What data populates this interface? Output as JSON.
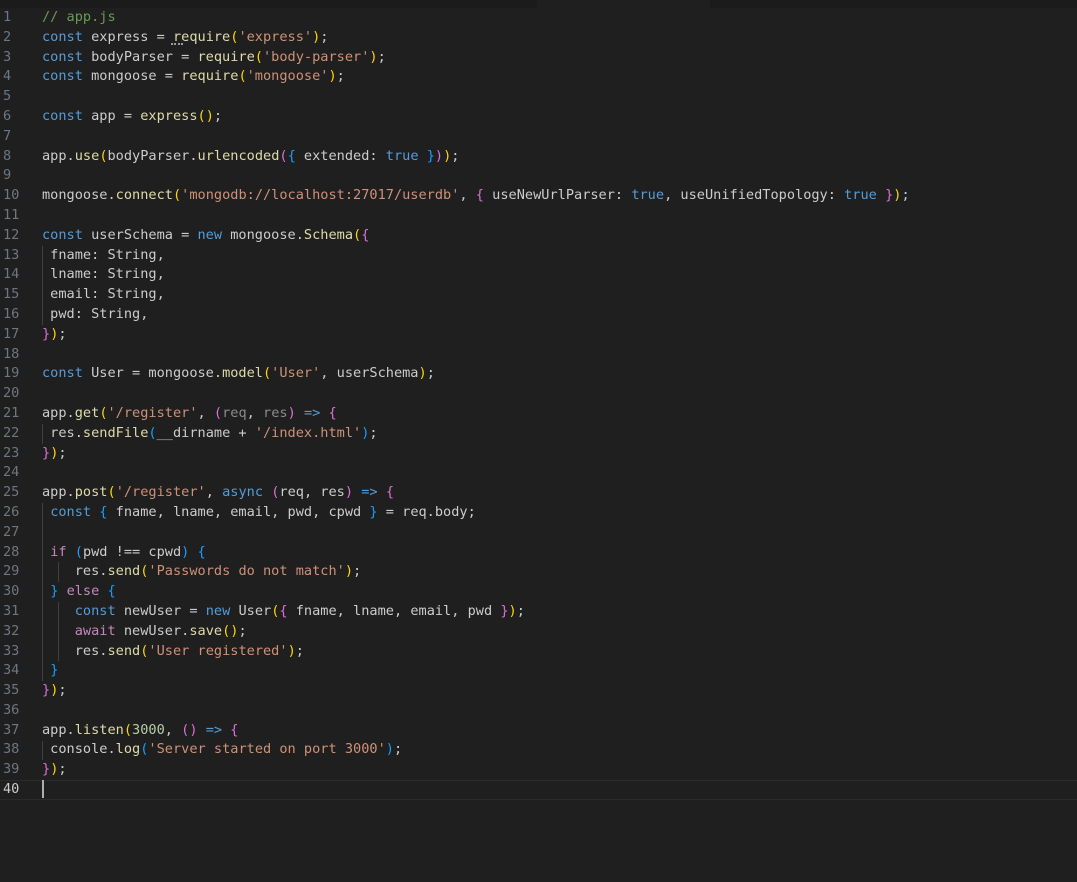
{
  "editor": {
    "current_line": 40,
    "lines": [
      {
        "n": "1",
        "tokens": [
          [
            "comment",
            "// app.js"
          ]
        ]
      },
      {
        "n": "2",
        "tokens": [
          [
            "keyword",
            "const"
          ],
          [
            "plain",
            " express = "
          ],
          [
            "fn",
            "require"
          ],
          [
            "b1",
            "("
          ],
          [
            "str",
            "'express'"
          ],
          [
            "b1",
            ")"
          ],
          [
            "plain",
            ";"
          ]
        ]
      },
      {
        "n": "3",
        "tokens": [
          [
            "keyword",
            "const"
          ],
          [
            "plain",
            " bodyParser = "
          ],
          [
            "fn",
            "require"
          ],
          [
            "b1",
            "("
          ],
          [
            "str",
            "'body-parser'"
          ],
          [
            "b1",
            ")"
          ],
          [
            "plain",
            ";"
          ]
        ]
      },
      {
        "n": "4",
        "tokens": [
          [
            "keyword",
            "const"
          ],
          [
            "plain",
            " mongoose = "
          ],
          [
            "fn",
            "require"
          ],
          [
            "b1",
            "("
          ],
          [
            "str",
            "'mongoose'"
          ],
          [
            "b1",
            ")"
          ],
          [
            "plain",
            ";"
          ]
        ]
      },
      {
        "n": "5",
        "tokens": []
      },
      {
        "n": "6",
        "tokens": [
          [
            "keyword",
            "const"
          ],
          [
            "plain",
            " app = "
          ],
          [
            "fn",
            "express"
          ],
          [
            "b1",
            "()"
          ],
          [
            "plain",
            ";"
          ]
        ]
      },
      {
        "n": "7",
        "tokens": []
      },
      {
        "n": "8",
        "tokens": [
          [
            "plain",
            "app."
          ],
          [
            "fn",
            "use"
          ],
          [
            "b1",
            "("
          ],
          [
            "plain",
            "bodyParser."
          ],
          [
            "fn",
            "urlencoded"
          ],
          [
            "b2",
            "("
          ],
          [
            "b3",
            "{"
          ],
          [
            "plain",
            " extended: "
          ],
          [
            "keyword",
            "true"
          ],
          [
            "plain",
            " "
          ],
          [
            "b3",
            "}"
          ],
          [
            "b2",
            ")"
          ],
          [
            "b1",
            ")"
          ],
          [
            "plain",
            ";"
          ]
        ]
      },
      {
        "n": "9",
        "tokens": []
      },
      {
        "n": "10",
        "tokens": [
          [
            "plain",
            "mongoose."
          ],
          [
            "fn",
            "connect"
          ],
          [
            "b1",
            "("
          ],
          [
            "str",
            "'mongodb://localhost:27017/userdb'"
          ],
          [
            "plain",
            ", "
          ],
          [
            "b2",
            "{"
          ],
          [
            "plain",
            " useNewUrlParser: "
          ],
          [
            "keyword",
            "true"
          ],
          [
            "plain",
            ", useUnifiedTopology: "
          ],
          [
            "keyword",
            "true"
          ],
          [
            "plain",
            " "
          ],
          [
            "b2",
            "}"
          ],
          [
            "b1",
            ")"
          ],
          [
            "plain",
            ";"
          ]
        ]
      },
      {
        "n": "11",
        "tokens": []
      },
      {
        "n": "12",
        "tokens": [
          [
            "keyword",
            "const"
          ],
          [
            "plain",
            " userSchema = "
          ],
          [
            "keyword",
            "new"
          ],
          [
            "plain",
            " mongoose."
          ],
          [
            "fn",
            "Schema"
          ],
          [
            "b1",
            "("
          ],
          [
            "b2",
            "{"
          ]
        ]
      },
      {
        "n": "13",
        "tokens": [
          [
            "plain",
            " fname: String,"
          ]
        ]
      },
      {
        "n": "14",
        "tokens": [
          [
            "plain",
            " lname: String,"
          ]
        ]
      },
      {
        "n": "15",
        "tokens": [
          [
            "plain",
            " email: String,"
          ]
        ]
      },
      {
        "n": "16",
        "tokens": [
          [
            "plain",
            " pwd: String,"
          ]
        ]
      },
      {
        "n": "17",
        "tokens": [
          [
            "b2",
            "}"
          ],
          [
            "b1",
            ")"
          ],
          [
            "plain",
            ";"
          ]
        ]
      },
      {
        "n": "18",
        "tokens": []
      },
      {
        "n": "19",
        "tokens": [
          [
            "keyword",
            "const"
          ],
          [
            "plain",
            " User = mongoose."
          ],
          [
            "fn",
            "model"
          ],
          [
            "b1",
            "("
          ],
          [
            "str",
            "'User'"
          ],
          [
            "plain",
            ", userSchema"
          ],
          [
            "b1",
            ")"
          ],
          [
            "plain",
            ";"
          ]
        ]
      },
      {
        "n": "20",
        "tokens": []
      },
      {
        "n": "21",
        "tokens": [
          [
            "plain",
            "app."
          ],
          [
            "fn",
            "get"
          ],
          [
            "b1",
            "("
          ],
          [
            "str",
            "'/register'"
          ],
          [
            "plain",
            ", "
          ],
          [
            "b2",
            "("
          ],
          [
            "dim",
            "req"
          ],
          [
            "plain",
            ", "
          ],
          [
            "dim",
            "res"
          ],
          [
            "b2",
            ")"
          ],
          [
            "plain",
            " "
          ],
          [
            "keyword",
            "=>"
          ],
          [
            "plain",
            " "
          ],
          [
            "b2",
            "{"
          ]
        ]
      },
      {
        "n": "22",
        "tokens": [
          [
            "plain",
            " res."
          ],
          [
            "fn",
            "sendFile"
          ],
          [
            "b3",
            "("
          ],
          [
            "plain",
            "__dirname + "
          ],
          [
            "str",
            "'/index.html'"
          ],
          [
            "b3",
            ")"
          ],
          [
            "plain",
            ";"
          ]
        ]
      },
      {
        "n": "23",
        "tokens": [
          [
            "b2",
            "}"
          ],
          [
            "b1",
            ")"
          ],
          [
            "plain",
            ";"
          ]
        ]
      },
      {
        "n": "24",
        "tokens": []
      },
      {
        "n": "25",
        "tokens": [
          [
            "plain",
            "app."
          ],
          [
            "fn",
            "post"
          ],
          [
            "b1",
            "("
          ],
          [
            "str",
            "'/register'"
          ],
          [
            "plain",
            ", "
          ],
          [
            "keyword",
            "async"
          ],
          [
            "plain",
            " "
          ],
          [
            "b2",
            "("
          ],
          [
            "plain",
            "req, res"
          ],
          [
            "b2",
            ")"
          ],
          [
            "plain",
            " "
          ],
          [
            "keyword",
            "=>"
          ],
          [
            "plain",
            " "
          ],
          [
            "b2",
            "{"
          ]
        ]
      },
      {
        "n": "26",
        "tokens": [
          [
            "plain",
            " "
          ],
          [
            "keyword",
            "const"
          ],
          [
            "plain",
            " "
          ],
          [
            "b3",
            "{"
          ],
          [
            "plain",
            " fname, lname, email, pwd, cpwd "
          ],
          [
            "b3",
            "}"
          ],
          [
            "plain",
            " = req.body;"
          ]
        ]
      },
      {
        "n": "27",
        "tokens": []
      },
      {
        "n": "28",
        "tokens": [
          [
            "plain",
            " "
          ],
          [
            "control",
            "if"
          ],
          [
            "plain",
            " "
          ],
          [
            "b3",
            "("
          ],
          [
            "plain",
            "pwd !== cpwd"
          ],
          [
            "b3",
            ")"
          ],
          [
            "plain",
            " "
          ],
          [
            "b3",
            "{"
          ]
        ]
      },
      {
        "n": "29",
        "tokens": [
          [
            "plain",
            "    res."
          ],
          [
            "fn",
            "send"
          ],
          [
            "b1",
            "("
          ],
          [
            "str",
            "'Passwords do not match'"
          ],
          [
            "b1",
            ")"
          ],
          [
            "plain",
            ";"
          ]
        ]
      },
      {
        "n": "30",
        "tokens": [
          [
            "plain",
            " "
          ],
          [
            "b3",
            "}"
          ],
          [
            "plain",
            " "
          ],
          [
            "control",
            "else"
          ],
          [
            "plain",
            " "
          ],
          [
            "b3",
            "{"
          ]
        ]
      },
      {
        "n": "31",
        "tokens": [
          [
            "plain",
            "    "
          ],
          [
            "keyword",
            "const"
          ],
          [
            "plain",
            " newUser = "
          ],
          [
            "keyword",
            "new"
          ],
          [
            "plain",
            " User"
          ],
          [
            "b1",
            "("
          ],
          [
            "b2",
            "{"
          ],
          [
            "plain",
            " fname, lname, email, pwd "
          ],
          [
            "b2",
            "}"
          ],
          [
            "b1",
            ")"
          ],
          [
            "plain",
            ";"
          ]
        ]
      },
      {
        "n": "32",
        "tokens": [
          [
            "plain",
            "    "
          ],
          [
            "control",
            "await"
          ],
          [
            "plain",
            " newUser."
          ],
          [
            "fn",
            "save"
          ],
          [
            "b1",
            "()"
          ],
          [
            "plain",
            ";"
          ]
        ]
      },
      {
        "n": "33",
        "tokens": [
          [
            "plain",
            "    res."
          ],
          [
            "fn",
            "send"
          ],
          [
            "b1",
            "("
          ],
          [
            "str",
            "'User registered'"
          ],
          [
            "b1",
            ")"
          ],
          [
            "plain",
            ";"
          ]
        ]
      },
      {
        "n": "34",
        "tokens": [
          [
            "plain",
            " "
          ],
          [
            "b3",
            "}"
          ]
        ]
      },
      {
        "n": "35",
        "tokens": [
          [
            "b2",
            "}"
          ],
          [
            "b1",
            ")"
          ],
          [
            "plain",
            ";"
          ]
        ]
      },
      {
        "n": "36",
        "tokens": []
      },
      {
        "n": "37",
        "tokens": [
          [
            "plain",
            "app."
          ],
          [
            "fn",
            "listen"
          ],
          [
            "b1",
            "("
          ],
          [
            "num",
            "3000"
          ],
          [
            "plain",
            ", "
          ],
          [
            "b2",
            "()"
          ],
          [
            "plain",
            " "
          ],
          [
            "keyword",
            "=>"
          ],
          [
            "plain",
            " "
          ],
          [
            "b2",
            "{"
          ]
        ]
      },
      {
        "n": "38",
        "tokens": [
          [
            "plain",
            " console."
          ],
          [
            "fn",
            "log"
          ],
          [
            "b3",
            "("
          ],
          [
            "str",
            "'Server started on port 3000'"
          ],
          [
            "b3",
            ")"
          ],
          [
            "plain",
            ";"
          ]
        ]
      },
      {
        "n": "39",
        "tokens": [
          [
            "b2",
            "}"
          ],
          [
            "b1",
            ")"
          ],
          [
            "plain",
            ";"
          ]
        ]
      },
      {
        "n": "40",
        "tokens": []
      }
    ]
  },
  "colors": {
    "background": "#1f1f1f",
    "line_number": "#6e7681",
    "keyword": "#569cd6",
    "function": "#dcdcaa",
    "string": "#ce9178",
    "comment": "#6a9955",
    "number": "#b5cea8"
  }
}
